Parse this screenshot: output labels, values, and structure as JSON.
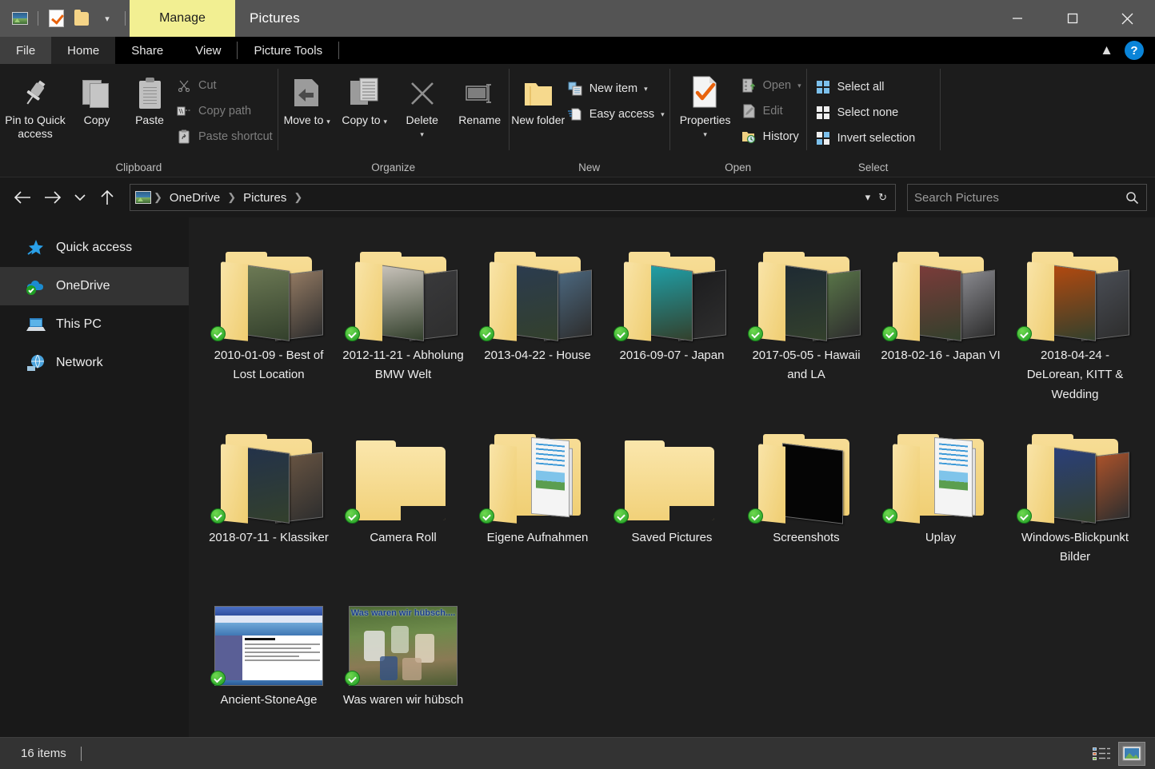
{
  "window": {
    "title": "Pictures",
    "contextual_tab": "Manage",
    "quick_access_icons": [
      "picture-icon",
      "properties-check-icon",
      "new-folder-icon",
      "customize-caret-icon"
    ],
    "controls": {
      "minimize": "minimize-icon",
      "maximize": "maximize-icon",
      "close": "close-icon"
    }
  },
  "tabs": {
    "file": "File",
    "items": [
      {
        "label": "Home",
        "active": true
      },
      {
        "label": "Share",
        "active": false
      },
      {
        "label": "View",
        "active": false
      },
      {
        "label": "Picture Tools",
        "active": false
      }
    ],
    "collapse_icon": "chevron-up-icon",
    "help_label": "?"
  },
  "ribbon": {
    "groups": [
      {
        "title": "Clipboard",
        "big": [
          {
            "label": "Pin to Quick access",
            "icon": "pin-icon",
            "dim": false
          },
          {
            "label": "Copy",
            "icon": "copy-icon",
            "dim": false
          },
          {
            "label": "Paste",
            "icon": "paste-icon",
            "dim": false
          }
        ],
        "small": [
          {
            "label": "Cut",
            "icon": "scissors-icon",
            "dim": true
          },
          {
            "label": "Copy path",
            "icon": "copy-path-icon",
            "dim": true
          },
          {
            "label": "Paste shortcut",
            "icon": "paste-shortcut-icon",
            "dim": true
          }
        ]
      },
      {
        "title": "Organize",
        "big": [
          {
            "label": "Move to",
            "icon": "move-to-icon",
            "caret": true
          },
          {
            "label": "Copy to",
            "icon": "copy-to-icon",
            "caret": true
          },
          {
            "label": "Delete",
            "icon": "delete-x-icon",
            "caret": true
          },
          {
            "label": "Rename",
            "icon": "rename-icon",
            "caret": false
          }
        ]
      },
      {
        "title": "New",
        "big": [
          {
            "label": "New folder",
            "icon": "new-folder-icon"
          }
        ],
        "small": [
          {
            "label": "New item",
            "icon": "new-item-icon",
            "caret": true
          },
          {
            "label": "Easy access",
            "icon": "easy-access-icon",
            "caret": true
          }
        ]
      },
      {
        "title": "Open",
        "big": [
          {
            "label": "Properties",
            "icon": "properties-icon",
            "caret": true
          }
        ],
        "small": [
          {
            "label": "Open",
            "icon": "open-icon",
            "caret": true,
            "dim": true
          },
          {
            "label": "Edit",
            "icon": "edit-icon",
            "dim": true
          },
          {
            "label": "History",
            "icon": "history-icon",
            "dim": false
          }
        ]
      },
      {
        "title": "Select",
        "small": [
          {
            "label": "Select all",
            "icon": "select-all-icon"
          },
          {
            "label": "Select none",
            "icon": "select-none-icon"
          },
          {
            "label": "Invert selection",
            "icon": "invert-selection-icon"
          }
        ]
      }
    ]
  },
  "navigation": {
    "back": "back-arrow-icon",
    "forward": "forward-arrow-icon",
    "recent": "recent-locations-icon",
    "up": "up-arrow-icon",
    "breadcrumbs": [
      "OneDrive",
      "Pictures"
    ],
    "dropdown_icon": "chevron-down-icon",
    "refresh_icon": "refresh-icon"
  },
  "search": {
    "placeholder": "Search Pictures",
    "value": "",
    "icon": "search-icon"
  },
  "sidebar": {
    "items": [
      {
        "label": "Quick access",
        "icon": "star-pin-icon",
        "selected": false
      },
      {
        "label": "OneDrive",
        "icon": "onedrive-cloud-icon",
        "selected": true
      },
      {
        "label": "This PC",
        "icon": "this-pc-icon",
        "selected": false
      },
      {
        "label": "Network",
        "icon": "network-icon",
        "selected": false
      }
    ]
  },
  "files": [
    {
      "name": "2010-01-09 - Best of Lost Location",
      "type": "folder-photos",
      "synced": true,
      "thumbs": [
        "#6d7a55",
        "#9a7f66"
      ]
    },
    {
      "name": "2012-11-21 - Abholung BMW Welt",
      "type": "folder-photos",
      "synced": true,
      "thumbs": [
        "#c9c3bb",
        "#3a3a3c"
      ]
    },
    {
      "name": "2013-04-22 - House",
      "type": "folder-photos",
      "synced": true,
      "thumbs": [
        "#2b3b4f",
        "#4d6b84"
      ]
    },
    {
      "name": "2016-09-07 - Japan",
      "type": "folder-photos",
      "synced": true,
      "thumbs": [
        "#1fa0a8",
        "#1b1b1d"
      ]
    },
    {
      "name": "2017-05-05 - Hawaii and LA",
      "type": "folder-photos",
      "synced": true,
      "thumbs": [
        "#1e2a33",
        "#5c7a4a"
      ]
    },
    {
      "name": "2018-02-16 - Japan VI",
      "type": "folder-photos",
      "synced": true,
      "thumbs": [
        "#7b3b3a",
        "#8f8f95"
      ]
    },
    {
      "name": "2018-04-24 - DeLorean, KITT & Wedding",
      "type": "folder-photos",
      "synced": true,
      "thumbs": [
        "#b3490f",
        "#4b4f57"
      ]
    },
    {
      "name": "2018-07-11 - Klassiker",
      "type": "folder-photos",
      "synced": true,
      "thumbs": [
        "#23324a",
        "#6b5643"
      ]
    },
    {
      "name": "Camera Roll",
      "type": "folder-plain",
      "synced": true
    },
    {
      "name": "Eigene Aufnahmen",
      "type": "folder-docs",
      "synced": true
    },
    {
      "name": "Saved Pictures",
      "type": "folder-plain",
      "synced": true
    },
    {
      "name": "Screenshots",
      "type": "folder-black",
      "synced": true
    },
    {
      "name": "Uplay",
      "type": "folder-docs",
      "synced": true
    },
    {
      "name": "Windows-Blickpunkt Bilder",
      "type": "folder-photos",
      "synced": true,
      "thumbs": [
        "#2a3f7a",
        "#b5552a"
      ]
    },
    {
      "name": "Ancient-StoneAge",
      "type": "image-screenshot",
      "synced": true
    },
    {
      "name": "Was waren wir hübsch",
      "type": "image-photo",
      "synced": true,
      "overlay_text": "Was waren wir hübsch...."
    }
  ],
  "status": {
    "item_count": "16 items",
    "views": [
      {
        "name": "details-view-icon",
        "active": false
      },
      {
        "name": "large-icons-view-icon",
        "active": true
      }
    ]
  },
  "colors": {
    "titlebar": "#545454",
    "contextual_tab": "#f2ef92",
    "ribbon": "#1c1c1c",
    "content_bg": "#1e1e1e",
    "accent_blue": "#0a84d8",
    "sync_green": "#1f9e24",
    "folder_yellow": "#f7dd96"
  }
}
